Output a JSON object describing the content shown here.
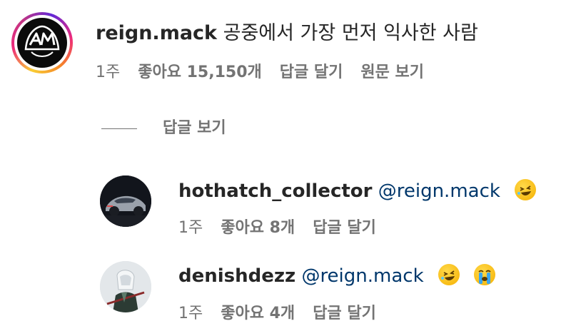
{
  "main_comment": {
    "username": "reign.mack",
    "text": "공중에서 가장 먼저 익사한 사람",
    "timestamp": "1주",
    "likes": "좋아요 15,150개",
    "reply_action": "답글 달기",
    "see_translation": "원문 보기"
  },
  "view_replies": {
    "label": "답글 보기"
  },
  "replies": [
    {
      "username": "hothatch_collector",
      "mention": "@reign.mack",
      "emojis": [
        "rofl-emoji"
      ],
      "timestamp": "1주",
      "likes": "좋아요 8개",
      "reply_action": "답글 달기"
    },
    {
      "username": "denishdezz",
      "mention": "@reign.mack",
      "emojis": [
        "rofl-emoji",
        "loudly-crying-emoji"
      ],
      "timestamp": "1주",
      "likes": "좋아요 4개",
      "reply_action": "답글 달기"
    }
  ],
  "colors": {
    "text": "#262626",
    "secondary": "#737373",
    "mention": "#00376b"
  }
}
